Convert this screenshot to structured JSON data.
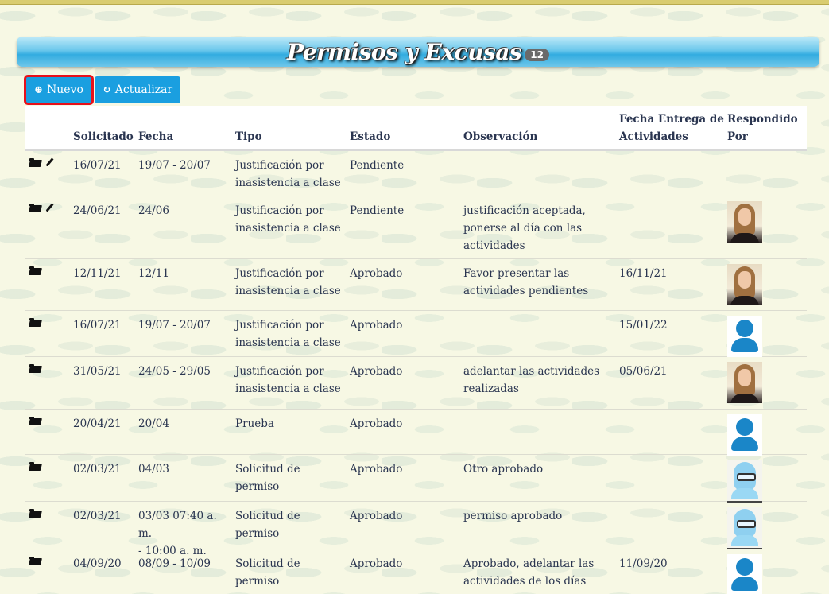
{
  "header": {
    "title": "Permisos y Excusas",
    "count": "12"
  },
  "toolbar": {
    "new_label": "Nuevo",
    "refresh_label": "Actualizar"
  },
  "table": {
    "columns": {
      "solicitado": "Solicitado",
      "fecha": "Fecha",
      "tipo": "Tipo",
      "estado": "Estado",
      "observacion": "Observación",
      "entrega_1": "Fecha Entrega de",
      "entrega_2": "Actividades",
      "respondido_1": "Respondido",
      "respondido_2": "Por"
    },
    "rows": [
      {
        "solicitado": "16/07/21",
        "fecha": [
          "19/07 - 20/07"
        ],
        "tipo": [
          "Justificación por",
          "inasistencia a clase"
        ],
        "estado": "Pendiente",
        "observacion": [],
        "entrega": "",
        "responder": "none",
        "editable": true
      },
      {
        "solicitado": "24/06/21",
        "fecha": [
          "24/06"
        ],
        "tipo": [
          "Justificación por",
          "inasistencia a clase"
        ],
        "estado": "Pendiente",
        "observacion": [
          "justificación aceptada,",
          "ponerse al día con las",
          "actividades"
        ],
        "entrega": "",
        "responder": "photo",
        "editable": true
      },
      {
        "solicitado": "12/11/21",
        "fecha": [
          "12/11"
        ],
        "tipo": [
          "Justificación por",
          "inasistencia a clase"
        ],
        "estado": "Aprobado",
        "observacion": [
          "Favor presentar las",
          "actividades pendientes"
        ],
        "entrega": "16/11/21",
        "responder": "photo",
        "editable": false
      },
      {
        "solicitado": "16/07/21",
        "fecha": [
          "19/07 - 20/07"
        ],
        "tipo": [
          "Justificación por",
          "inasistencia a clase"
        ],
        "estado": "Aprobado",
        "observacion": [],
        "entrega": "15/01/22",
        "responder": "generic",
        "editable": false
      },
      {
        "solicitado": "31/05/21",
        "fecha": [
          "24/05 - 29/05"
        ],
        "tipo": [
          "Justificación por",
          "inasistencia a clase"
        ],
        "estado": "Aprobado",
        "observacion": [
          "adelantar las actividades",
          "realizadas"
        ],
        "entrega": "05/06/21",
        "responder": "photo",
        "editable": false
      },
      {
        "solicitado": "20/04/21",
        "fecha": [
          "20/04"
        ],
        "tipo": [
          "Prueba"
        ],
        "estado": "Aprobado",
        "observacion": [],
        "entrega": "",
        "responder": "generic",
        "editable": false
      },
      {
        "solicitado": "02/03/21",
        "fecha": [
          "04/03"
        ],
        "tipo": [
          "Solicitud de permiso"
        ],
        "estado": "Aprobado",
        "observacion": [
          "Otro aprobado"
        ],
        "entrega": "",
        "responder": "cartoon",
        "editable": false
      },
      {
        "solicitado": "02/03/21",
        "fecha": [
          "03/03 07:40 a. m.",
          "- 10:00 a. m."
        ],
        "tipo": [
          "Solicitud de permiso"
        ],
        "estado": "Aprobado",
        "observacion": [
          "permiso aprobado"
        ],
        "entrega": "",
        "responder": "cartoon",
        "editable": false
      },
      {
        "solicitado": "04/09/20",
        "fecha": [
          "08/09 - 10/09"
        ],
        "tipo": [
          "Solicitud de permiso"
        ],
        "estado": "Aprobado",
        "observacion": [
          "Aprobado, adelantar las",
          "actividades de los días"
        ],
        "entrega": "11/09/20",
        "responder": "generic",
        "editable": false
      }
    ]
  }
}
